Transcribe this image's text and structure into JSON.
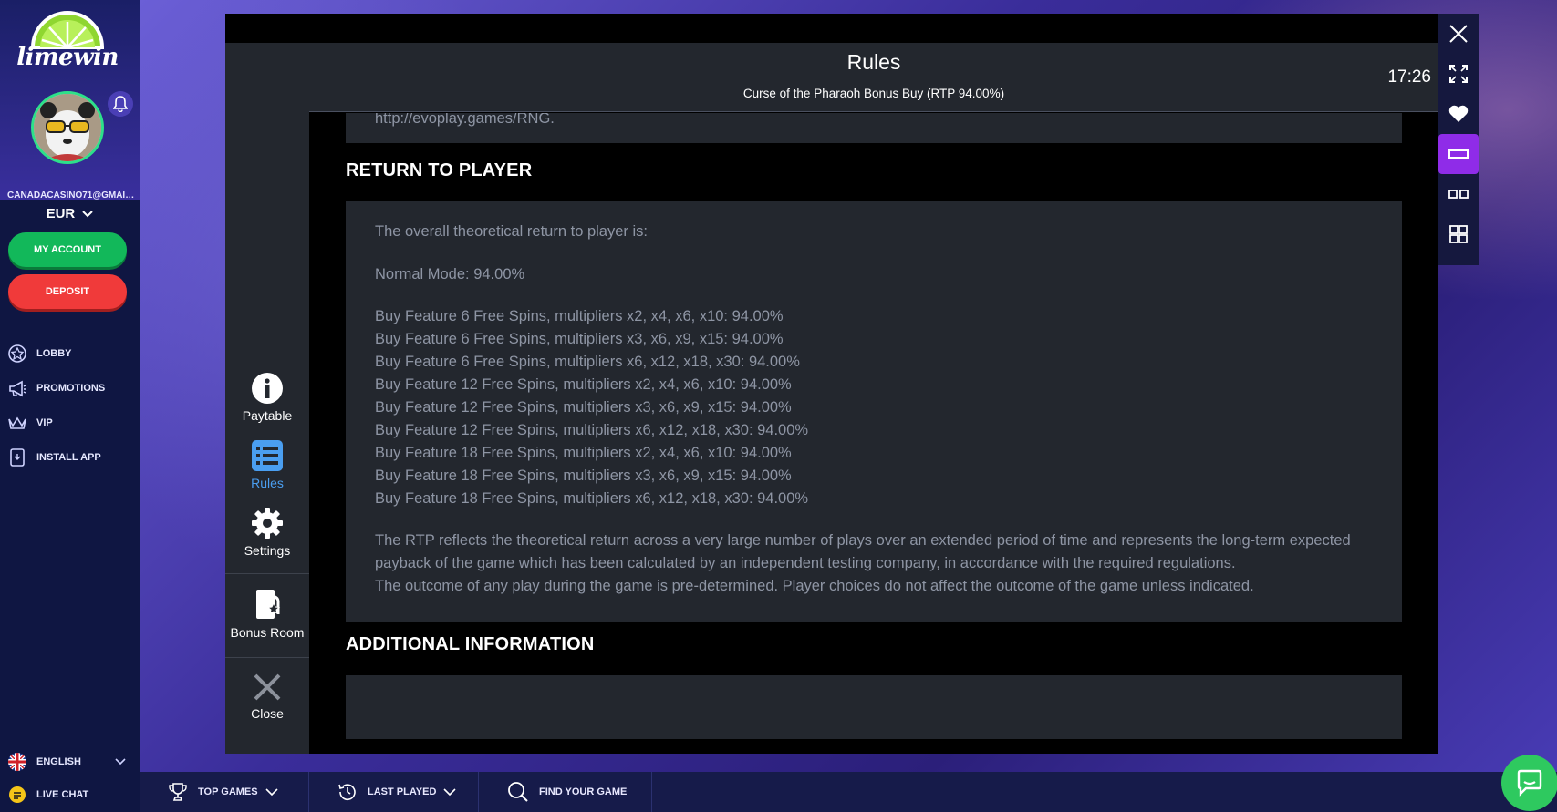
{
  "brand": {
    "logo_text": "limewin"
  },
  "user": {
    "email": "CANADACASINO71@GMAIL...",
    "currency": "EUR"
  },
  "sidebar": {
    "my_account_label": "MY ACCOUNT",
    "deposit_label": "DEPOSIT",
    "items": [
      {
        "label": "LOBBY",
        "icon": "lobby-icon"
      },
      {
        "label": "PROMOTIONS",
        "icon": "megaphone-icon"
      },
      {
        "label": "VIP",
        "icon": "crown-icon"
      },
      {
        "label": "INSTALL APP",
        "icon": "phone-icon"
      }
    ],
    "language": "ENGLISH",
    "live_chat": "LIVE CHAT"
  },
  "bottom_bar": {
    "top_games": "TOP GAMES",
    "last_played": "LAST PLAYED",
    "find_game": "FIND YOUR GAME"
  },
  "game": {
    "header_title": "Rules",
    "header_subtitle": "Curse of the Pharaoh Bonus Buy (RTP 94.00%)",
    "clock": "17:26",
    "menu": [
      {
        "label": "Paytable",
        "icon": "info-icon"
      },
      {
        "label": "Rules",
        "icon": "list-icon"
      },
      {
        "label": "Settings",
        "icon": "gear-icon"
      },
      {
        "label": "Bonus Room",
        "icon": "bonus-card-icon"
      },
      {
        "label": "Close",
        "icon": "close-icon"
      }
    ],
    "rng_link": "http://evoplay.games/RNG.",
    "rtp_heading": "RETURN TO PLAYER",
    "rtp_intro": "The overall theoretical return to player is:",
    "rtp_normal": "Normal Mode: 94.00%",
    "rtp_lines": [
      "Buy Feature 6 Free Spins, multipliers x2, x4, x6, x10: 94.00%",
      "Buy Feature 6 Free Spins, multipliers x3, x6, x9, x15: 94.00%",
      "Buy Feature 6 Free Spins, multipliers x6, x12, x18, x30: 94.00%",
      "Buy Feature 12 Free Spins, multipliers x2, x4, x6, x10: 94.00%",
      "Buy Feature 12 Free Spins, multipliers x3, x6, x9, x15: 94.00%",
      "Buy Feature 12 Free Spins, multipliers x6, x12, x18, x30: 94.00%",
      "Buy Feature 18 Free Spins, multipliers x2, x4, x6, x10: 94.00%",
      "Buy Feature 18 Free Spins, multipliers x3, x6, x9, x15: 94.00%",
      "Buy Feature 18 Free Spins, multipliers x6, x12, x18, x30: 94.00%"
    ],
    "rtp_description": "The RTP reflects the theoretical return across a very large number of plays over an extended period of time and represents the long-term expected payback of the game which has been calculated by an independent testing company, in accordance with the required regulations.",
    "rtp_outcome": "The outcome of any play during the game is pre-determined. Player choices do not affect the outcome of the game unless indicated.",
    "additional_heading": "ADDITIONAL INFORMATION"
  },
  "colors": {
    "accent_green": "#12b85a",
    "accent_red": "#f03a3a",
    "accent_purple": "#8f2ce8",
    "rules_active_blue": "#4a9ef0"
  }
}
